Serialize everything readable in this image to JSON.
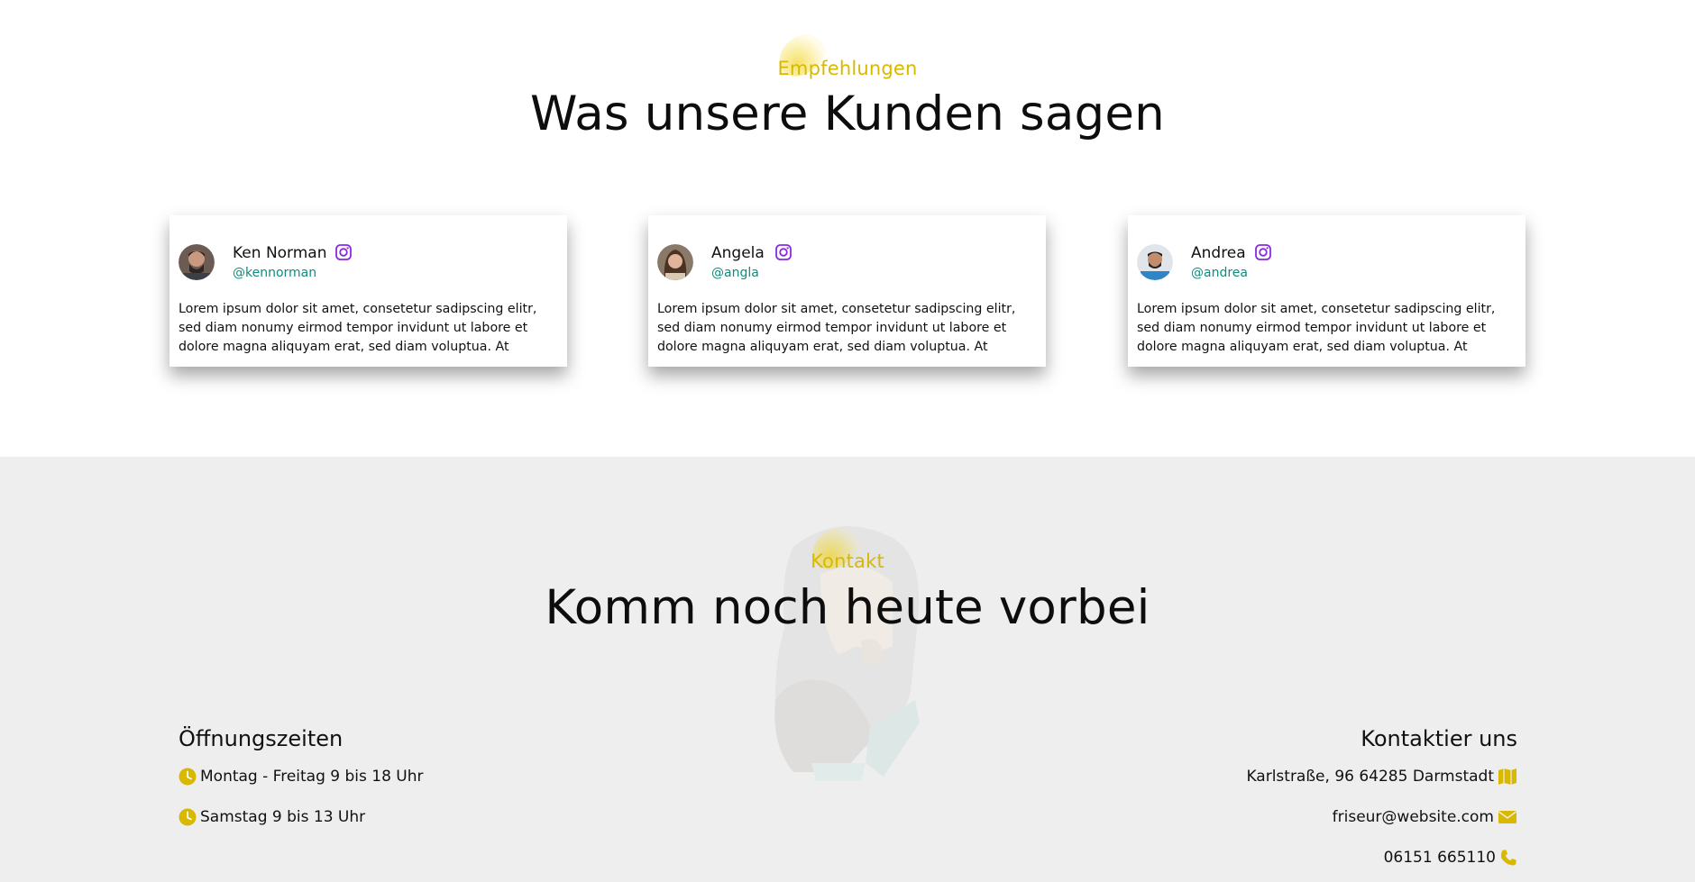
{
  "testimonials": {
    "eyebrow": "Empfehlungen",
    "title": "Was unsere Kunden sagen",
    "cards": [
      {
        "name": "Ken Norman",
        "handle": "@kennorman",
        "text": "Lorem ipsum dolor sit amet, consetetur sadipscing elitr, sed diam nonumy eirmod tempor invidunt ut labore et dolore magna aliquyam erat, sed diam voluptua. At",
        "social_icon": "instagram-icon"
      },
      {
        "name": "Angela",
        "handle": "@angla",
        "text": "Lorem ipsum dolor sit amet, consetetur sadipscing elitr, sed diam nonumy eirmod tempor invidunt ut labore et dolore magna aliquyam erat, sed diam voluptua. At",
        "social_icon": "instagram-icon"
      },
      {
        "name": "Andrea",
        "handle": "@andrea",
        "text": "Lorem ipsum dolor sit amet, consetetur sadipscing elitr, sed diam nonumy eirmod tempor invidunt ut labore et dolore magna aliquyam erat, sed diam voluptua. At",
        "social_icon": "instagram-icon"
      }
    ]
  },
  "contact": {
    "eyebrow": "Kontakt",
    "title": "Komm noch heute vorbei",
    "hours": {
      "title": "Öffnungszeiten",
      "items": [
        "Montag - Freitag 9 bis 18 Uhr",
        "Samstag 9 bis 13 Uhr"
      ],
      "icon": "clock-icon"
    },
    "reach": {
      "title": "Kontaktier uns",
      "address": "Karlstraße, 96 64285 Darmstadt",
      "email": "friseur@website.com",
      "phone": "06151 665110",
      "icons": [
        "map-icon",
        "envelope-icon",
        "phone-icon"
      ]
    }
  },
  "colors": {
    "accent": "#d9b800",
    "handle": "#0f8c7c",
    "instagram": "#8a2be2",
    "section_bg": "#eeeeee"
  }
}
